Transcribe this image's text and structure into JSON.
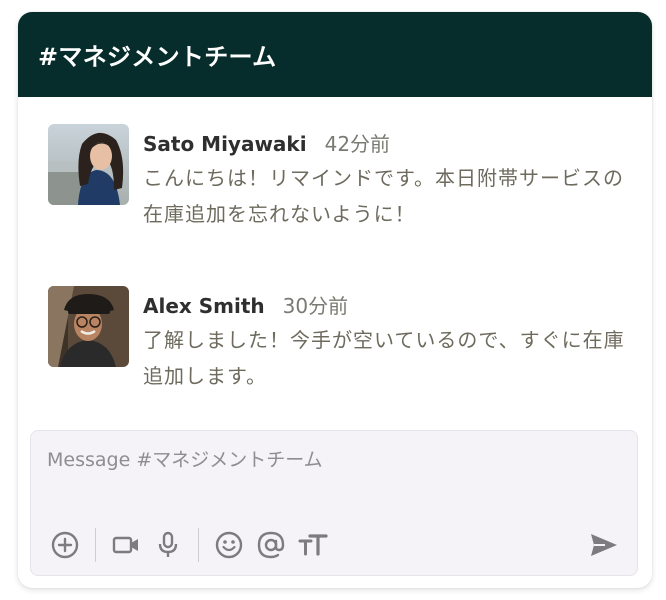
{
  "channel": {
    "title": "#マネジメントチーム"
  },
  "messages": [
    {
      "author": "Sato Miyawaki",
      "time": "42分前",
      "text": "こんにちは！リマインドです。本日附帯サービスの在庫追加を忘れないように！",
      "avatar": "avatar-woman-photo"
    },
    {
      "author": "Alex Smith",
      "time": "30分前",
      "text": "了解しました！今手が空いているので、すぐに在庫追加します。",
      "avatar": "avatar-man-photo"
    }
  ],
  "composer": {
    "placeholder": "Message #マネジメントチーム",
    "value": ""
  },
  "toolbar": {
    "icons": [
      "plus-circle-icon",
      "video-camera-icon",
      "microphone-icon",
      "emoji-icon",
      "mention-icon",
      "text-format-icon"
    ],
    "send_icon": "send-icon"
  },
  "colors": {
    "header_bg": "#062c2b",
    "header_text": "#ffffff",
    "message_text": "#6e6b5e",
    "timestamp": "#7a7a72",
    "composer_bg": "#f5f3f7",
    "icon": "#7d7a80"
  }
}
